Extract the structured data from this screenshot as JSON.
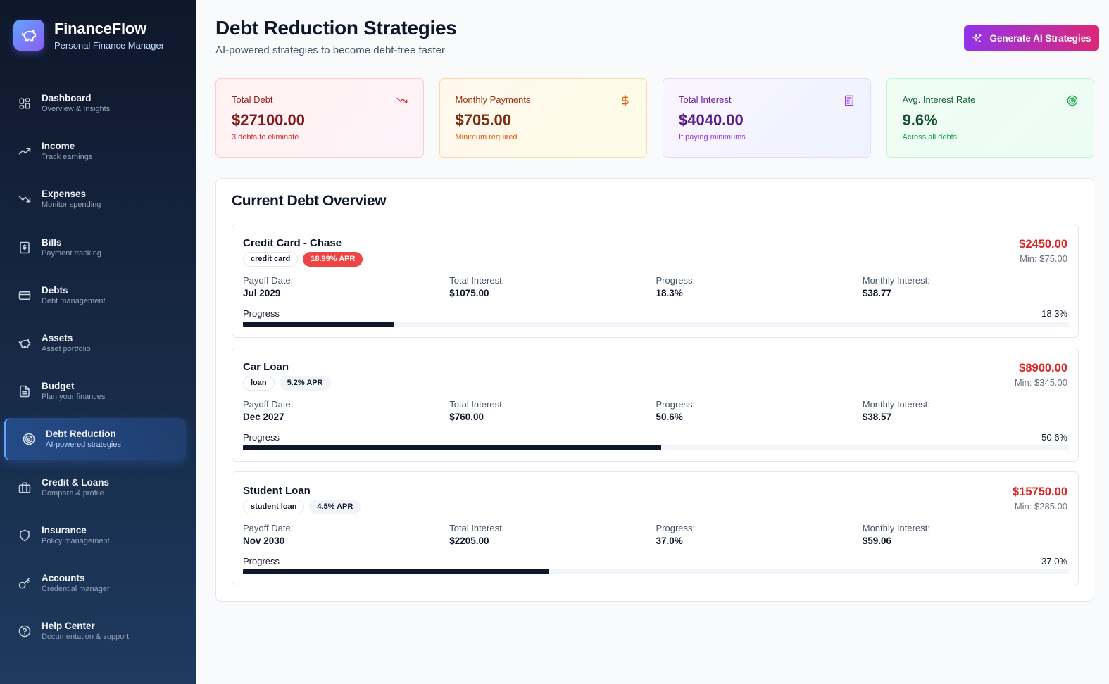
{
  "brand": {
    "name": "FinanceFlow",
    "subtitle": "Personal Finance Manager"
  },
  "sidebar": {
    "items": [
      {
        "label": "Dashboard",
        "sub": "Overview & Insights",
        "icon": "dashboard-icon"
      },
      {
        "label": "Income",
        "sub": "Track earnings",
        "icon": "trending-up-icon"
      },
      {
        "label": "Expenses",
        "sub": "Monitor spending",
        "icon": "trending-down-icon"
      },
      {
        "label": "Bills",
        "sub": "Payment tracking",
        "icon": "receipt-icon"
      },
      {
        "label": "Debts",
        "sub": "Debt management",
        "icon": "credit-card-icon"
      },
      {
        "label": "Assets",
        "sub": "Asset portfolio",
        "icon": "piggy-bank-icon"
      },
      {
        "label": "Budget",
        "sub": "Plan your finances",
        "icon": "document-icon"
      },
      {
        "label": "Debt Reduction",
        "sub": "AI-powered strategies",
        "icon": "target-icon",
        "active": true
      },
      {
        "label": "Credit & Loans",
        "sub": "Compare & profile",
        "icon": "briefcase-icon"
      },
      {
        "label": "Insurance",
        "sub": "Policy management",
        "icon": "shield-icon"
      },
      {
        "label": "Accounts",
        "sub": "Credential manager",
        "icon": "key-icon"
      },
      {
        "label": "Help Center",
        "sub": "Documentation & support",
        "icon": "help-circle-icon"
      }
    ]
  },
  "header": {
    "title": "Debt Reduction Strategies",
    "subtitle": "AI-powered strategies to become debt-free faster",
    "generate_button": "Generate AI Strategies"
  },
  "stats": [
    {
      "label": "Total Debt",
      "value": "$27100.00",
      "note": "3 debts to eliminate",
      "icon": "trending-down-icon"
    },
    {
      "label": "Monthly Payments",
      "value": "$705.00",
      "note": "Minimum required",
      "icon": "dollar-icon"
    },
    {
      "label": "Total Interest",
      "value": "$4040.00",
      "note": "If paying minimums",
      "icon": "calculator-icon"
    },
    {
      "label": "Avg. Interest Rate",
      "value": "9.6%",
      "note": "Across all debts",
      "icon": "target-icon"
    }
  ],
  "overview": {
    "title": "Current Debt Overview",
    "labels": {
      "payoff_date": "Payoff Date:",
      "total_interest": "Total Interest:",
      "progress": "Progress:",
      "monthly_interest": "Monthly Interest:",
      "progress_bar": "Progress"
    },
    "debts": [
      {
        "name": "Credit Card - Chase",
        "type": "credit card",
        "apr": "18.99% APR",
        "amount": "$2450.00",
        "min": "Min: $75.00",
        "payoff_date": "Jul 2029",
        "total_interest": "$1075.00",
        "progress": "18.3%",
        "monthly_interest": "$38.77",
        "progress_value": 18.3
      },
      {
        "name": "Car Loan",
        "type": "loan",
        "apr": "5.2% APR",
        "amount": "$8900.00",
        "min": "Min: $345.00",
        "payoff_date": "Dec 2027",
        "total_interest": "$760.00",
        "progress": "50.6%",
        "monthly_interest": "$38.57",
        "progress_value": 50.6
      },
      {
        "name": "Student Loan",
        "type": "student loan",
        "apr": "4.5% APR",
        "amount": "$15750.00",
        "min": "Min: $285.00",
        "payoff_date": "Nov 2030",
        "total_interest": "$2205.00",
        "progress": "37.0%",
        "monthly_interest": "$59.06",
        "progress_value": 37.0
      }
    ]
  }
}
